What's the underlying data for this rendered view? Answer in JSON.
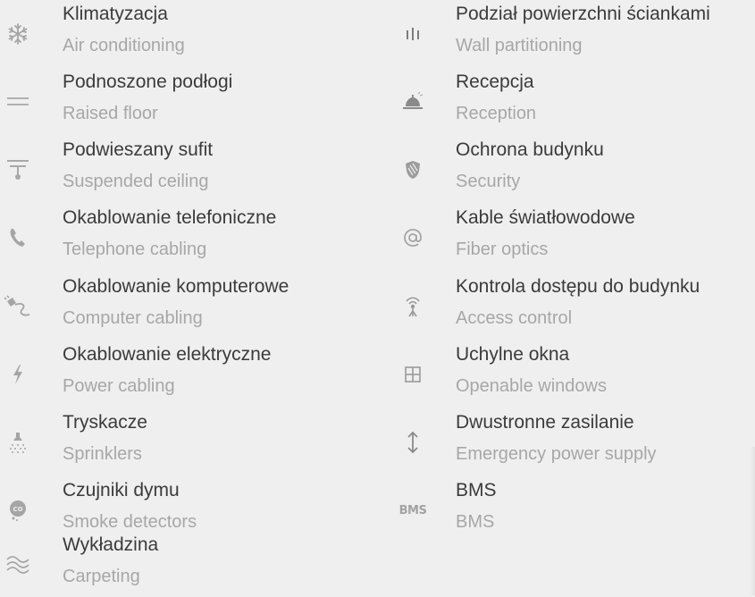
{
  "left": [
    {
      "pl": "Klimatyzacja",
      "en": "Air conditioning",
      "icon": "snowflake-icon"
    },
    {
      "pl": "Podnoszone podłogi",
      "en": "Raised floor",
      "icon": "raised-floor-icon"
    },
    {
      "pl": "Podwieszany sufit",
      "en": "Suspended ceiling",
      "icon": "ceiling-lamp-icon"
    },
    {
      "pl": "Okablowanie telefoniczne",
      "en": "Telephone cabling",
      "icon": "phone-icon"
    },
    {
      "pl": "Okablowanie komputerowe",
      "en": "Computer cabling",
      "icon": "plug-cable-icon"
    },
    {
      "pl": "Okablowanie elektryczne",
      "en": "Power cabling",
      "icon": "lightning-icon"
    },
    {
      "pl": "Tryskacze",
      "en": "Sprinklers",
      "icon": "sprinkler-icon"
    },
    {
      "pl": "Czujniki dymu",
      "en": "Smoke detectors",
      "icon": "co2-cloud-icon"
    },
    {
      "pl": "Wykładzina",
      "en": "Carpeting",
      "icon": "waves-icon"
    }
  ],
  "right": [
    {
      "pl": "Podział powierzchni ściankami",
      "en": "Wall partitioning",
      "icon": "wall-partition-icon"
    },
    {
      "pl": "Recepcja",
      "en": "Reception",
      "icon": "reception-bell-icon"
    },
    {
      "pl": "Ochrona budynku",
      "en": "Security",
      "icon": "shield-icon"
    },
    {
      "pl": "Kable światłowodowe",
      "en": "Fiber optics",
      "icon": "at-sign-icon"
    },
    {
      "pl": "Kontrola dostępu do budynku",
      "en": "Access control",
      "icon": "antenna-icon"
    },
    {
      "pl": "Uchylne okna",
      "en": "Openable windows",
      "icon": "window-icon"
    },
    {
      "pl": "Dwustronne zasilanie",
      "en": "Emergency power supply",
      "icon": "up-down-arrow-icon"
    },
    {
      "pl": "BMS",
      "en": "BMS",
      "icon": "bms-icon"
    }
  ],
  "icons": {
    "bms_text": "BMS"
  }
}
